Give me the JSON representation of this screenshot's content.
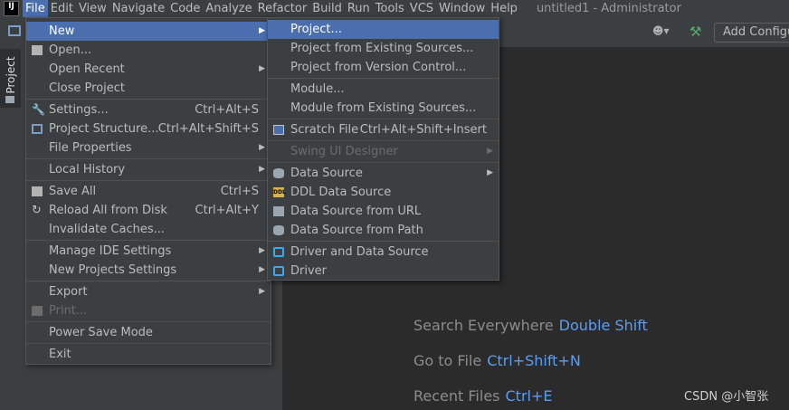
{
  "menubar": {
    "items": [
      "File",
      "Edit",
      "View",
      "Navigate",
      "Code",
      "Analyze",
      "Refactor",
      "Build",
      "Run",
      "Tools",
      "VCS",
      "Window",
      "Help"
    ],
    "window_title": "untitled1 - Administrator"
  },
  "toolbar": {
    "add_config": "Add Configu"
  },
  "sidebar": {
    "project_tab": "Project"
  },
  "file_menu": {
    "new": "New",
    "open": "Open...",
    "open_recent": "Open Recent",
    "close_project": "Close Project",
    "settings": "Settings...",
    "settings_sc": "Ctrl+Alt+S",
    "project_structure": "Project Structure...",
    "project_structure_sc": "Ctrl+Alt+Shift+S",
    "file_properties": "File Properties",
    "local_history": "Local History",
    "save_all": "Save All",
    "save_all_sc": "Ctrl+S",
    "reload": "Reload All from Disk",
    "reload_sc": "Ctrl+Alt+Y",
    "invalidate": "Invalidate Caches...",
    "manage_ide": "Manage IDE Settings",
    "new_projects_settings": "New Projects Settings",
    "export": "Export",
    "print": "Print...",
    "power_save": "Power Save Mode",
    "exit": "Exit"
  },
  "new_menu": {
    "project": "Project...",
    "from_existing": "Project from Existing Sources...",
    "from_vcs": "Project from Version Control...",
    "module": "Module...",
    "module_existing": "Module from Existing Sources...",
    "scratch": "Scratch File",
    "scratch_sc": "Ctrl+Alt+Shift+Insert",
    "swing": "Swing UI Designer",
    "data_source": "Data Source",
    "ddl": "DDL Data Source",
    "ds_url": "Data Source from URL",
    "ds_path": "Data Source from Path",
    "driver_ds": "Driver and Data Source",
    "driver": "Driver"
  },
  "hints": {
    "search": "Search Everywhere",
    "search_sc": "Double Shift",
    "goto": "Go to File",
    "goto_sc": "Ctrl+Shift+N",
    "recent": "Recent Files",
    "recent_sc": "Ctrl+E"
  },
  "watermark": "CSDN @小智张",
  "colors": {
    "selection": "#4b6eaf",
    "shortcut": "#589df6",
    "bg": "#2b2b2b",
    "panel": "#3c3f41"
  }
}
